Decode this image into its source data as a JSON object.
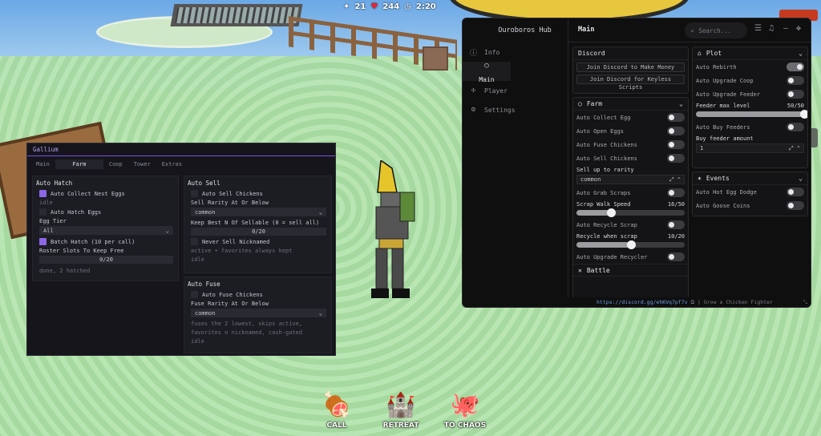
{
  "hud": {
    "stat1": "21",
    "stat2": "244",
    "time": "2:20"
  },
  "actions": [
    {
      "label": "CALL",
      "icon": "🍖"
    },
    {
      "label": "RETREAT",
      "icon": "🏰"
    },
    {
      "label": "TO CHAOS",
      "icon": "🐙"
    }
  ],
  "gallium": {
    "title": "Gallium",
    "tabs": [
      "Main",
      "Farm",
      "Coop",
      "Tower",
      "Extras"
    ],
    "active_tab": "Farm",
    "auto_hatch": {
      "header": "Auto Hatch",
      "collect_label": "Auto Collect Nest Eggs",
      "collect_on": true,
      "status1": "idle",
      "hatch_label": "Auto Hatch Eggs",
      "egg_tier_label": "Egg Tier",
      "egg_tier_value": "All",
      "batch_label": "Batch Hatch (10 per call)",
      "roster_label": "Roster Slots To Keep Free",
      "roster_value": "0/20",
      "status2": "done, 2 hatched"
    },
    "auto_sell": {
      "header": "Auto Sell",
      "sell_label": "Auto Sell Chickens",
      "rarity_label": "Sell Rarity At Or Below",
      "rarity_value": "common",
      "keep_label": "Keep Best N Of Sellable (0 = sell all)",
      "keep_value": "0/20",
      "never_label": "Never Sell Nicknamed",
      "note": "active • favorites always kept",
      "status": "idle"
    },
    "auto_fuse": {
      "header": "Auto Fuse",
      "fuse_label": "Auto Fuse Chickens",
      "rarity_label": "Fuse Rarity At Or Below",
      "rarity_value": "common",
      "note1": "fuses the 2 lowest, skips active,",
      "note2": "favorites n nicknamed, cash-gated",
      "status": "idle"
    }
  },
  "hub": {
    "title": "Ouroboros Hub",
    "nav": [
      {
        "label": "Info",
        "icon": "ⓘ"
      },
      {
        "label": "Main",
        "icon": "○"
      },
      {
        "label": "Player",
        "icon": "✣"
      },
      {
        "label": "Settings",
        "icon": "⚙"
      }
    ],
    "page_title": "Main",
    "search_placeholder": "Search...",
    "discord": {
      "header": "Discord",
      "btn1": "Join Discord to Make Money",
      "btn2": "Join Discord for Keyless Scripts"
    },
    "farm": {
      "header": "Farm",
      "rows": [
        {
          "label": "Auto Collect Egg",
          "on": false
        },
        {
          "label": "Auto Open Eggs",
          "on": false
        },
        {
          "label": "Auto Fuse Chickens",
          "on": false
        },
        {
          "label": "Auto Sell Chickens",
          "on": false
        }
      ],
      "sell_rarity_label": "Sell up to rarity",
      "sell_rarity_value": "common",
      "grab_label": "Auto Grab Scraps",
      "scrap_speed_label": "Scrap Walk Speed",
      "scrap_speed_value": "16/50",
      "scrap_speed_pct": 32,
      "recycle_label": "Auto Recycle Scrap",
      "recycle_when_label": "Recycle when scrap",
      "recycle_when_value": "10/20",
      "recycle_when_pct": 50,
      "upgrade_recycler_label": "Auto Upgrade Recycler",
      "next_header": "Battle"
    },
    "plot": {
      "header": "Plot",
      "rebirth_label": "Auto Rebirth",
      "rebirth_on": true,
      "coop_label": "Auto Upgrade Coop",
      "coop_on": false,
      "feeder_label": "Auto Upgrade Feeder",
      "feeder_on": false,
      "feeder_max_label": "Feeder max level",
      "feeder_max_value": "50/50",
      "feeder_max_pct": 100,
      "buy_feeders_label": "Auto Buy Feeders",
      "buy_amount_label": "Buy feeder amount",
      "buy_amount_value": "1"
    },
    "events": {
      "header": "Events",
      "hot_label": "Auto Hot Egg Dodge",
      "goose_label": "Auto Goose Coins"
    },
    "footer_link": "https://discord.gg/ehKVq7pf7v",
    "footer_text": "| Grow a Chicken Fighter"
  }
}
